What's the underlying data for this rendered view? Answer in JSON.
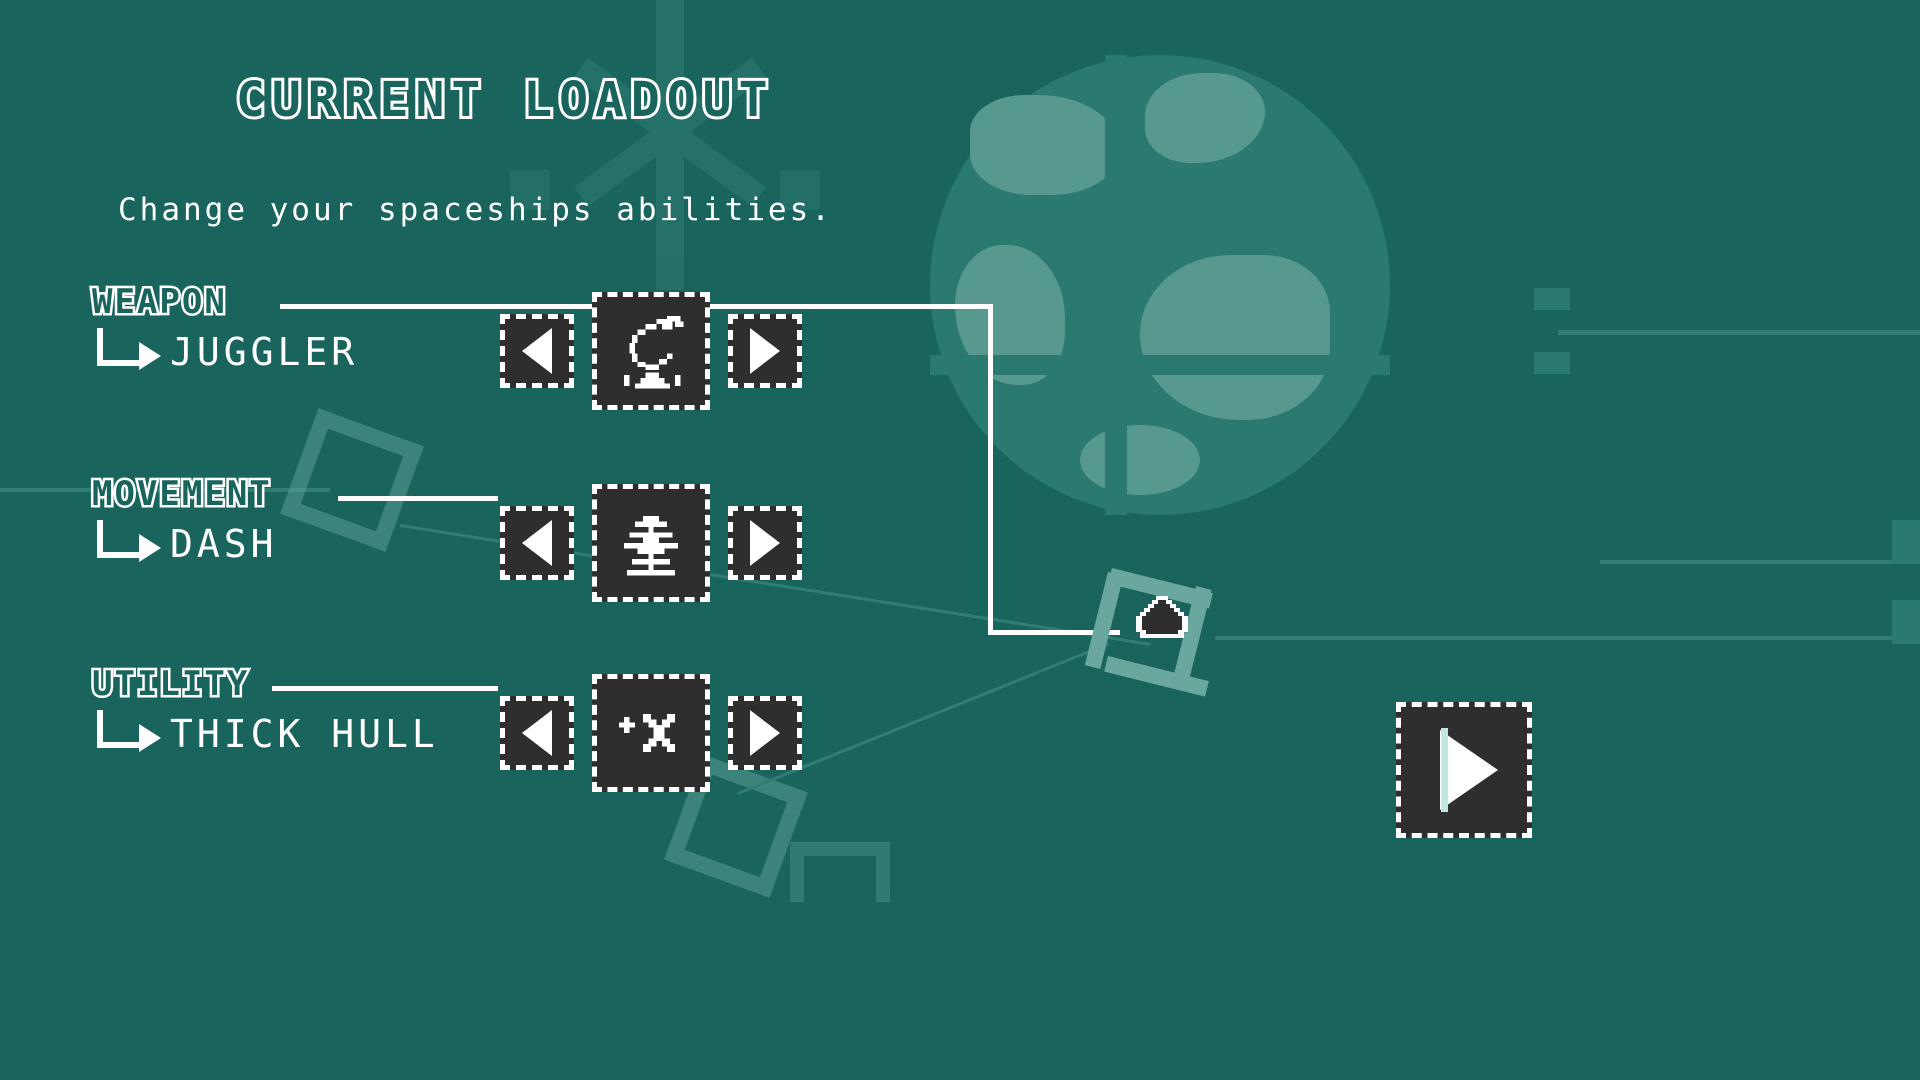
{
  "theme": {
    "background": "#19655e",
    "panel_dark": "#2e2e2e",
    "accent_white": "#ffffff",
    "decor_light": "#6aa79e",
    "planet_base": "#2a7a71",
    "planet_land": "#57988f"
  },
  "header": {
    "title": "CURRENT LOADOUT",
    "subtitle": "Change your spaceships abilities."
  },
  "loadout": {
    "rows": [
      {
        "category": "WEAPON",
        "item": "JUGGLER",
        "prev_label": "◀",
        "next_label": "▶",
        "icon": "juggler-weapon-icon"
      },
      {
        "category": "MOVEMENT",
        "item": "DASH",
        "prev_label": "◀",
        "next_label": "▶",
        "icon": "dash-movement-icon"
      },
      {
        "category": "UTILITY",
        "item": "THICK HULL",
        "prev_label": "◀",
        "next_label": "▶",
        "icon": "thick-hull-icon"
      }
    ]
  },
  "map": {
    "node_icon": "player-ship-marker",
    "connector_label": ""
  },
  "actions": {
    "play_label": "▶",
    "play_name": "start-run-button"
  }
}
